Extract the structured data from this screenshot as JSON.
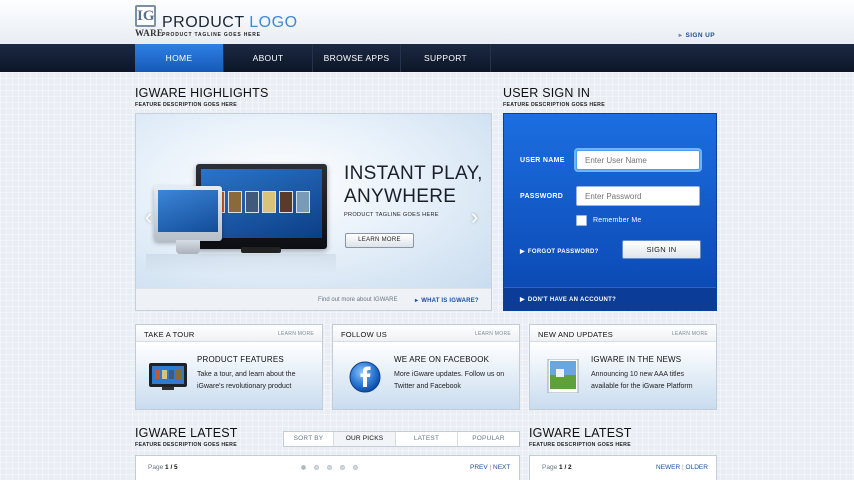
{
  "header": {
    "logo_mark": "IG",
    "logo_ware": "WARE",
    "logo_title_1": "PRODUCT",
    "logo_title_2": "LOGO",
    "logo_tagline": "PRODUCT TAGLINE GOES HERE",
    "signup_label": "SIGN UP"
  },
  "nav": {
    "items": [
      {
        "label": "HOME",
        "active": true
      },
      {
        "label": "ABOUT"
      },
      {
        "label": "BROWSE APPS"
      },
      {
        "label": "SUPPORT"
      }
    ]
  },
  "highlights": {
    "title": "IGWARE HIGHLIGHTS",
    "subtitle": "FEATURE DESCRIPTION GOES HERE",
    "slide_heading_line1": "INSTANT PLAY,",
    "slide_heading_line2": "ANYWHERE",
    "slide_tagline": "PRODUCT TAGLINE GOES HERE",
    "learn_more": "LEARN MORE",
    "find_out": "Find out more about IGWARE",
    "what_is": "WHAT IS IGWARE?",
    "prev_arrow": "‹",
    "next_arrow": "›"
  },
  "signin": {
    "title": "USER SIGN IN",
    "subtitle": "FEATURE DESCRIPTION GOES HERE",
    "username_label": "USER NAME",
    "username_placeholder": "Enter User Name",
    "password_label": "PASSWORD",
    "password_placeholder": "Enter Password",
    "remember_label": "Remember Me",
    "forgot_label": "FORGOT PASSWORD?",
    "signin_button": "SIGN IN",
    "no_account": "DON'T HAVE AN ACCOUNT?"
  },
  "cards": [
    {
      "title": "TAKE A TOUR",
      "more": "LEARN MORE",
      "heading": "PRODUCT FEATURES",
      "text": "Take a tour, and learn about the iGware's revolutionary product",
      "icon": "tv-icon"
    },
    {
      "title": "FOLLOW US",
      "more": "LEARN MORE",
      "heading": "WE ARE ON FACEBOOK",
      "text": "More iGware updates. Follow us on Twitter and Facebook",
      "icon": "facebook-icon"
    },
    {
      "title": "NEW AND UPDATES",
      "more": "LEARN MORE",
      "heading": "IGWARE IN THE NEWS",
      "text": "Announcing 10 new AAA titles available for the iGware Platform",
      "icon": "game-box-icon"
    }
  ],
  "latest_left": {
    "title": "IGWARE LATEST",
    "subtitle": "FEATURE DESCRIPTION GOES HERE",
    "sort_tabs": [
      {
        "label": "SORT BY"
      },
      {
        "label": "OUR PICKS",
        "active": true
      },
      {
        "label": "LATEST"
      },
      {
        "label": "POPULAR"
      }
    ],
    "page_prefix": "Page",
    "page_current": "1",
    "page_total": "/ 5",
    "prev": "PREV",
    "separator": "|",
    "next": "NEXT"
  },
  "latest_right": {
    "title": "IGWARE LATEST",
    "subtitle": "FEATURE DESCRIPTION GOES HERE",
    "page_prefix": "Page",
    "page_current": "1",
    "page_total": "/ 2",
    "newer": "NEWER",
    "separator": "|",
    "older": "OLDER"
  },
  "colors": {
    "nav_bg": "#0d1628",
    "nav_active": "#1f6fd6",
    "signin_bg": "#1464d2",
    "link": "#1c4fa0"
  }
}
